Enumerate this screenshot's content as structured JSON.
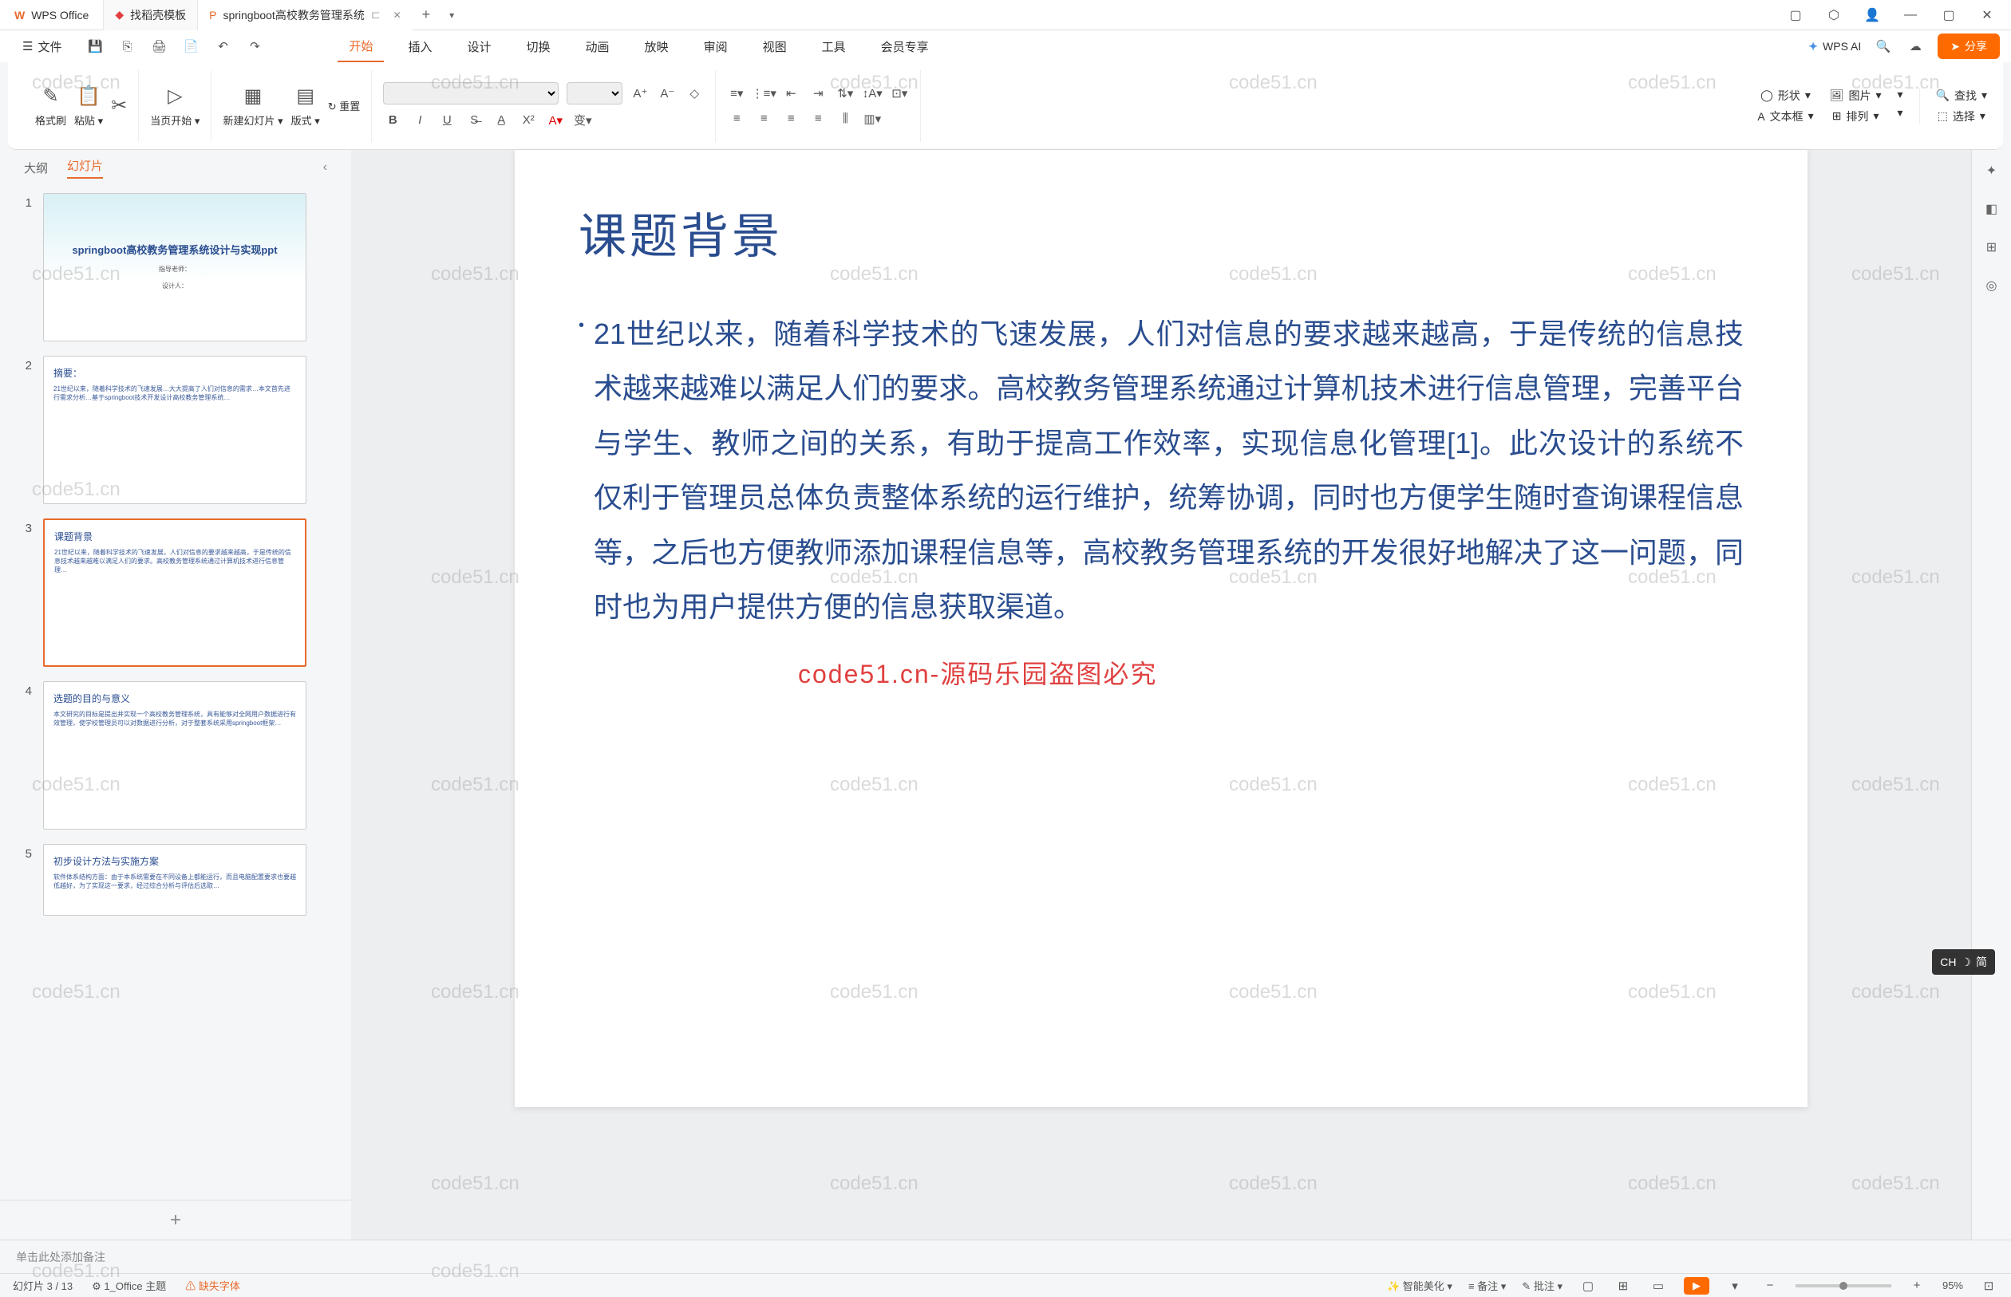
{
  "titlebar": {
    "app_name": "WPS Office",
    "tabs": [
      {
        "label": "找稻壳模板"
      },
      {
        "label": "springboot高校教务管理系统",
        "active": true
      }
    ]
  },
  "menubar": {
    "file": "文件",
    "items": [
      "开始",
      "插入",
      "设计",
      "切换",
      "动画",
      "放映",
      "审阅",
      "视图",
      "工具",
      "会员专享"
    ],
    "active_index": 0,
    "wps_ai": "WPS AI",
    "share": "分享"
  },
  "ribbon": {
    "format_brush": "格式刷",
    "paste": "粘贴",
    "from_current": "当页开始",
    "new_slide": "新建幻灯片",
    "layout": "版式",
    "reset": "重置",
    "shape": "形状",
    "picture": "图片",
    "textbox": "文本框",
    "arrange": "排列",
    "find": "查找",
    "select": "选择"
  },
  "panel": {
    "tabs": [
      "大纲",
      "幻灯片"
    ],
    "active": 1,
    "thumbs": [
      {
        "num": "1",
        "title": "springboot高校教务管理系统设计与实现ppt",
        "sub1": "指导老师：",
        "sub2": "设计人："
      },
      {
        "num": "2",
        "title": "摘要：",
        "text": "21世纪以来，随着科学技术的飞速发展…大大提高了人们对信息的需求…本文首先进行需求分析…基于springboot技术开发设计高校教务管理系统…"
      },
      {
        "num": "3",
        "title": "课题背景",
        "text": "21世纪以来，随着科学技术的飞速发展，人们对信息的要求越来越高，于是传统的信息技术越来越难以满足人们的要求。高校教务管理系统通过计算机技术进行信息管理…"
      },
      {
        "num": "4",
        "title": "选题的目的与意义",
        "text": "本文研究的目标是提出并实现一个高校教务管理系统，具有能够对全网用户数据进行有效管理，使学校管理员可以对数据进行分析，对于整套系统采用springboot框架…"
      },
      {
        "num": "5",
        "title": "初步设计方法与实施方案",
        "text": "软件体系结构方面：由于本系统需要在不同设备上都能运行，而且电脑配置要求也要越低越好，为了实现这一要求，经过综合分析与评估后选取…"
      }
    ]
  },
  "slide": {
    "title": "课题背景",
    "body": "21世纪以来，随着科学技术的飞速发展，人们对信息的要求越来越高，于是传统的信息技术越来越难以满足人们的要求。高校教务管理系统通过计算机技术进行信息管理，完善平台与学生、教师之间的关系，有助于提高工作效率，实现信息化管理[1]。此次设计的系统不仅利于管理员总体负责整体系统的运行维护，统筹协调，同时也方便学生随时查询课程信息等，之后也方便教师添加课程信息等，高校教务管理系统的开发很好地解决了这一问题，同时也为用户提供方便的信息获取渠道。"
  },
  "notes": {
    "placeholder": "单击此处添加备注"
  },
  "statusbar": {
    "slide_pos": "幻灯片 3 / 13",
    "theme": "1_Office 主题",
    "missing_font": "缺失字体",
    "beautify": "智能美化",
    "notes_btn": "备注",
    "review": "批注",
    "zoom": "95%"
  },
  "watermark": {
    "text": "code51.cn",
    "red": "code51.cn-源码乐园盗图必究"
  },
  "ime": {
    "lang": "CH",
    "mode": "简"
  }
}
